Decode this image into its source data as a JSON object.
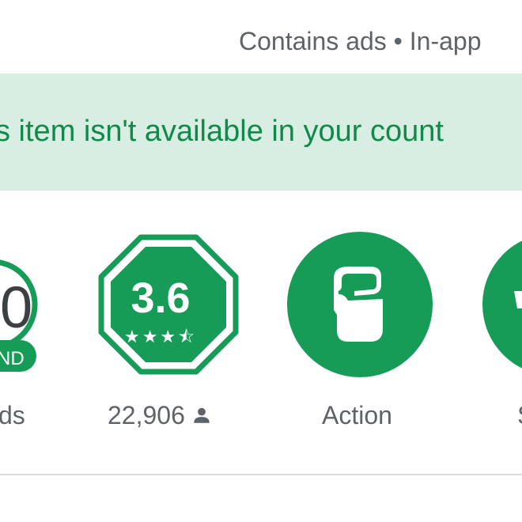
{
  "header": {
    "meta": "Contains ads • In-app"
  },
  "banner": {
    "message": "s item isn't available in your count"
  },
  "stats": {
    "downloads": {
      "number_fragment": "0",
      "badge_fragment": "ND",
      "label_fragment": "ds"
    },
    "rating": {
      "value": "3.6",
      "stars": "★★★⯪",
      "reviews": "22,906"
    },
    "category": {
      "label": "Action"
    },
    "fourth": {
      "label_fragment": "S"
    }
  },
  "colors": {
    "accent_green": "#169c56",
    "banner_bg": "#d9eee3",
    "banner_text": "#0f8a4b",
    "gray_text": "#5f6368"
  }
}
